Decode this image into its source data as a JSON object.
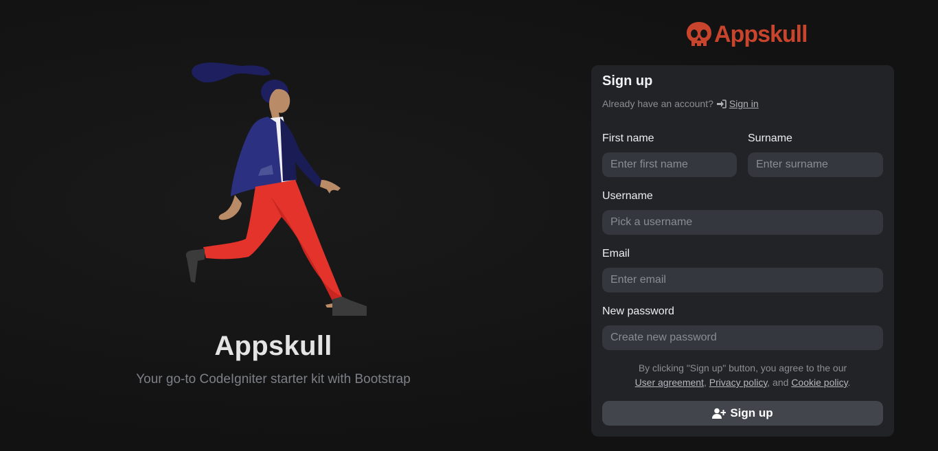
{
  "hero": {
    "title": "Appskull",
    "subtitle": "Your go-to CodeIgniter starter kit with Bootstrap"
  },
  "brand": {
    "name": "Appskull",
    "color": "#c8442d",
    "icon": "skull-icon"
  },
  "form": {
    "title": "Sign up",
    "have_account_text": "Already have an account?",
    "sign_in_label": "Sign in",
    "sign_in_icon": "sign-in-icon",
    "first_name": {
      "label": "First name",
      "placeholder": "Enter first name",
      "value": ""
    },
    "surname": {
      "label": "Surname",
      "placeholder": "Enter surname",
      "value": ""
    },
    "username": {
      "label": "Username",
      "placeholder": "Pick a username",
      "value": ""
    },
    "email": {
      "label": "Email",
      "placeholder": "Enter email",
      "value": ""
    },
    "password": {
      "label": "New password",
      "placeholder": "Create new password",
      "value": ""
    },
    "terms": {
      "prefix": "By clicking \"Sign up\" button, you agree to the our",
      "user_agreement": "User agreement",
      "sep1": ", ",
      "privacy_policy": "Privacy policy",
      "sep2": ", and ",
      "cookie_policy": "Cookie policy",
      "suffix": "."
    },
    "submit_label": "Sign up",
    "submit_icon": "user-plus-icon"
  },
  "colors": {
    "background": "#141414",
    "card": "#212327",
    "input": "#34373d",
    "button": "#42454c"
  }
}
